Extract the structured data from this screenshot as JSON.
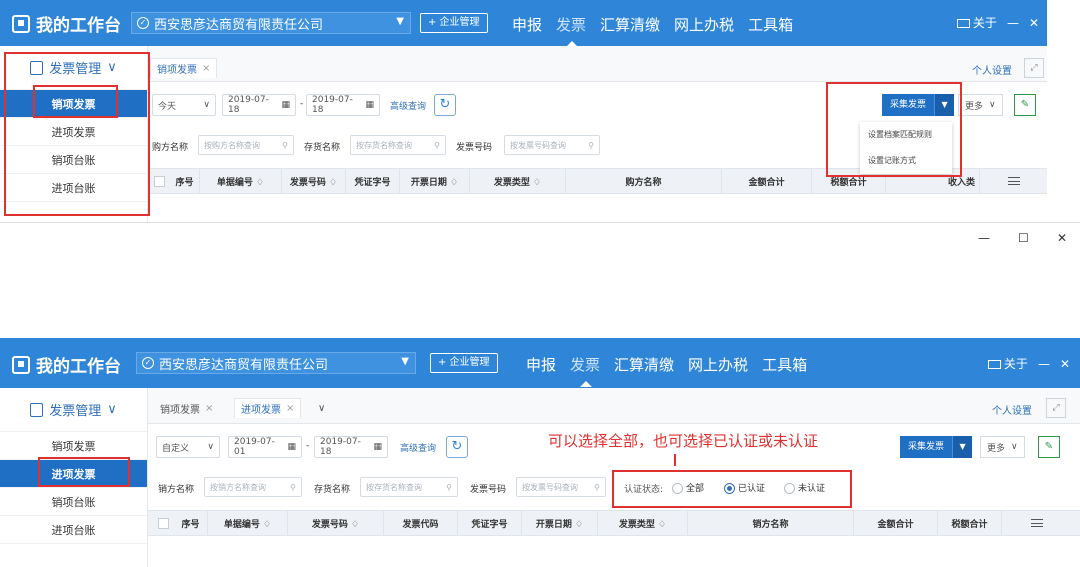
{
  "app": {
    "title": "我的工作台",
    "company": "西安思彦达商贸有限责任公司",
    "enterprise_btn": "+ 企业管理",
    "nav": [
      "申报",
      "发票",
      "汇算清缴",
      "网上办税",
      "工具箱"
    ],
    "active_nav": "发票",
    "about": "关于",
    "minimize": "—",
    "close": "✕"
  },
  "sidebar": {
    "title": "发票管理",
    "items": [
      "销项发票",
      "进项发票",
      "销项台账",
      "进项台账"
    ]
  },
  "panel1": {
    "tabs": [
      {
        "label": "销项发票"
      }
    ],
    "personal_settings": "个人设置",
    "date_select": "今天",
    "date_from": "2019-07-18",
    "date_sep": "-",
    "date_to": "2019-07-18",
    "advanced": "高级查询",
    "collect": "采集发票",
    "more": "更多",
    "filters": [
      {
        "label": "购方名称",
        "placeholder": "按购方名称查询"
      },
      {
        "label": "存货名称",
        "placeholder": "按存货名称查询"
      },
      {
        "label": "发票号码",
        "placeholder": "按发票号码查询"
      }
    ],
    "columns": [
      "序号",
      "单据编号 ♢",
      "发票号码 ♢",
      "凭证字号",
      "开票日期 ♢",
      "发票类型 ♢",
      "购方名称",
      "金额合计",
      "税额合计",
      "收入类"
    ],
    "dropdown": [
      "设置档案匹配规则",
      "设置记账方式"
    ]
  },
  "window_controls": [
    "—",
    "☐",
    "✕"
  ],
  "panel2": {
    "tabs": [
      {
        "label": "销项发票"
      },
      {
        "label": "进项发票"
      }
    ],
    "personal_settings": "个人设置",
    "date_select": "自定义",
    "date_from": "2019-07-01",
    "date_sep": "-",
    "date_to": "2019-07-18",
    "advanced": "高级查询",
    "collect": "采集发票",
    "more": "更多",
    "annotation": "可以选择全部，也可选择已认证或未认证",
    "filters": [
      {
        "label": "销方名称",
        "placeholder": "按销方名称查询"
      },
      {
        "label": "存货名称",
        "placeholder": "按存货名称查询"
      },
      {
        "label": "发票号码",
        "placeholder": "按发票号码查询"
      }
    ],
    "cert_label": "认证状态:",
    "cert_options": [
      "全部",
      "已认证",
      "未认证"
    ],
    "cert_selected": "已认证",
    "columns": [
      "序号",
      "单据编号 ♢",
      "发票号码 ♢",
      "发票代码",
      "凭证字号",
      "开票日期 ♢",
      "发票类型 ♢",
      "销方名称",
      "金额合计",
      "税额合计"
    ]
  },
  "colors": {
    "brand": "#2f86d9",
    "active": "#1f6fc5",
    "annotation": "#e03030"
  }
}
